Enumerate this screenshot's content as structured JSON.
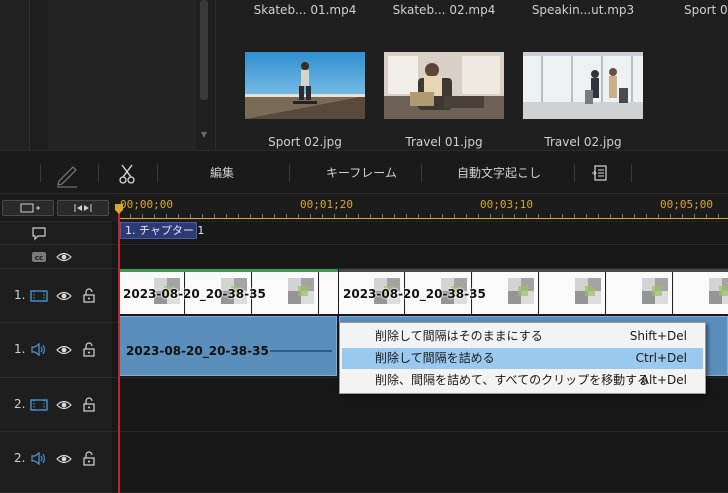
{
  "media_library": {
    "top_row": [
      {
        "label": "Skateb... 01.mp4"
      },
      {
        "label": "Skateb... 02.mp4"
      },
      {
        "label": "Speakin...ut.mp3"
      },
      {
        "label": "Sport 0"
      }
    ],
    "items": [
      {
        "label": "Sport 02.jpg"
      },
      {
        "label": "Travel 01.jpg"
      },
      {
        "label": "Travel 02.jpg"
      }
    ]
  },
  "toolbar": {
    "pen_icon": "pen-icon",
    "scissors_icon": "scissors-icon",
    "edit_label": "編集",
    "keyframe_label": "キーフレーム",
    "auto_caption_label": "自動文字起こし",
    "export_icon": "subtitle-list-icon"
  },
  "ruler": {
    "t0": "00;00;00",
    "t1": "00;01;20",
    "t2": "00;03;10",
    "t3": "00;05;00"
  },
  "chapter": {
    "label": "1. チャプター 1"
  },
  "tracks": [
    {
      "num": "1.",
      "type": "video"
    },
    {
      "num": "1.",
      "type": "audio"
    },
    {
      "num": "2.",
      "type": "video"
    },
    {
      "num": "2.",
      "type": "audio"
    }
  ],
  "clips": {
    "video_1": {
      "title": "2023-08-20_20-38-35"
    },
    "video_2": {
      "title": "2023-08-20_20-38-35"
    },
    "audio_1": {
      "title": "2023-08-20_20-38-35"
    }
  },
  "context_menu": {
    "items": [
      {
        "label": "削除して間隔はそのままにする",
        "shortcut": "Shift+Del",
        "highlighted": false
      },
      {
        "label": "削除して間隔を詰める",
        "shortcut": "Ctrl+Del",
        "highlighted": true
      },
      {
        "label": "削除、間隔を詰めて、すべてのクリップを移動する",
        "shortcut": "Alt+Del",
        "highlighted": false
      }
    ]
  },
  "colors": {
    "ruler_accent": "#d6a735",
    "playhead": "#c0262c",
    "menu_highlight": "#99c9ef",
    "audio_clip": "#5a8fbc",
    "chapter": "#2e3a72"
  }
}
